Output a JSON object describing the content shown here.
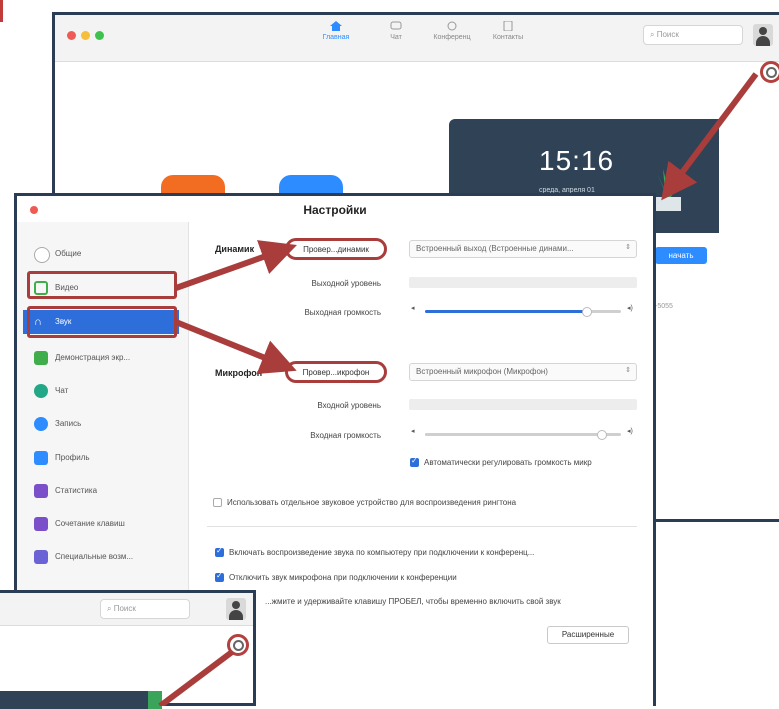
{
  "main_window": {
    "nav": [
      {
        "label": "Главная",
        "icon": "home-icon",
        "active": true
      },
      {
        "label": "Чат",
        "icon": "chat-icon",
        "active": false
      },
      {
        "label": "Конференц",
        "icon": "meetings-icon",
        "active": false
      },
      {
        "label": "Контакты",
        "icon": "contacts-icon",
        "active": false
      }
    ],
    "search_placeholder": "Поиск",
    "clock_time": "15:16",
    "clock_date": "среда, апреля 01",
    "start_label": "начать",
    "meeting_id": "-5055"
  },
  "settings": {
    "title": "Настройки",
    "sidebar": [
      {
        "label": "Общие",
        "icon": "general-icon",
        "color": "#9e9e9e"
      },
      {
        "label": "Видео",
        "icon": "video-icon",
        "color": "#3fae4a"
      },
      {
        "label": "Звук",
        "icon": "headphones-icon",
        "color": "#ffffff",
        "active": true
      },
      {
        "label": "Демонстрация экр...",
        "icon": "screen-share-icon",
        "color": "#3fae4a"
      },
      {
        "label": "Чат",
        "icon": "chat-icon",
        "color": "#23a887"
      },
      {
        "label": "Запись",
        "icon": "record-icon",
        "color": "#2d8cff"
      },
      {
        "label": "Профиль",
        "icon": "profile-icon",
        "color": "#2d8cff"
      },
      {
        "label": "Статистика",
        "icon": "statistics-icon",
        "color": "#7a4fc9"
      },
      {
        "label": "Сочетание клавиш",
        "icon": "keyboard-icon",
        "color": "#7a4fc9"
      },
      {
        "label": "Специальные возм...",
        "icon": "accessibility-icon",
        "color": "#6b62d6"
      }
    ],
    "speaker": {
      "section_label": "Динамик",
      "test_label": "Провер...динамик",
      "device": "Встроенный выход (Встроенные динами...",
      "level_label": "Выходной уровень",
      "volume_label": "Выходная громкость",
      "volume_level": 0.82
    },
    "microphone": {
      "section_label": "Микрофон",
      "test_label": "Провер...икрофон",
      "device": "Встроенный микрофон (Микрофон)",
      "level_label": "Входной уровень",
      "volume_label": "Входная громкость",
      "volume_level": 0.9,
      "auto_adjust_label": "Автоматически регулировать громкость микр",
      "auto_adjust": true
    },
    "separate_device_label": "Использовать отдельное звуковое устройство для воспроизведения рингтона",
    "separate_device": false,
    "join_audio_label": "Включать воспроизведение звука по компьютеру при подключении к конференц...",
    "join_audio": true,
    "mute_mic_label": "Отключить звук микрофона при подключении к конференции",
    "mute_mic": true,
    "space_label": "...жмите и удерживайте клавишу ПРОБЕЛ, чтобы временно включить свой звук",
    "advanced_label": "Расширенные"
  },
  "small_window": {
    "search_placeholder": "Поиск"
  },
  "colors": {
    "accent": "#2d6edb",
    "highlight": "#a93d3c",
    "zoom_blue": "#2d8cff"
  }
}
